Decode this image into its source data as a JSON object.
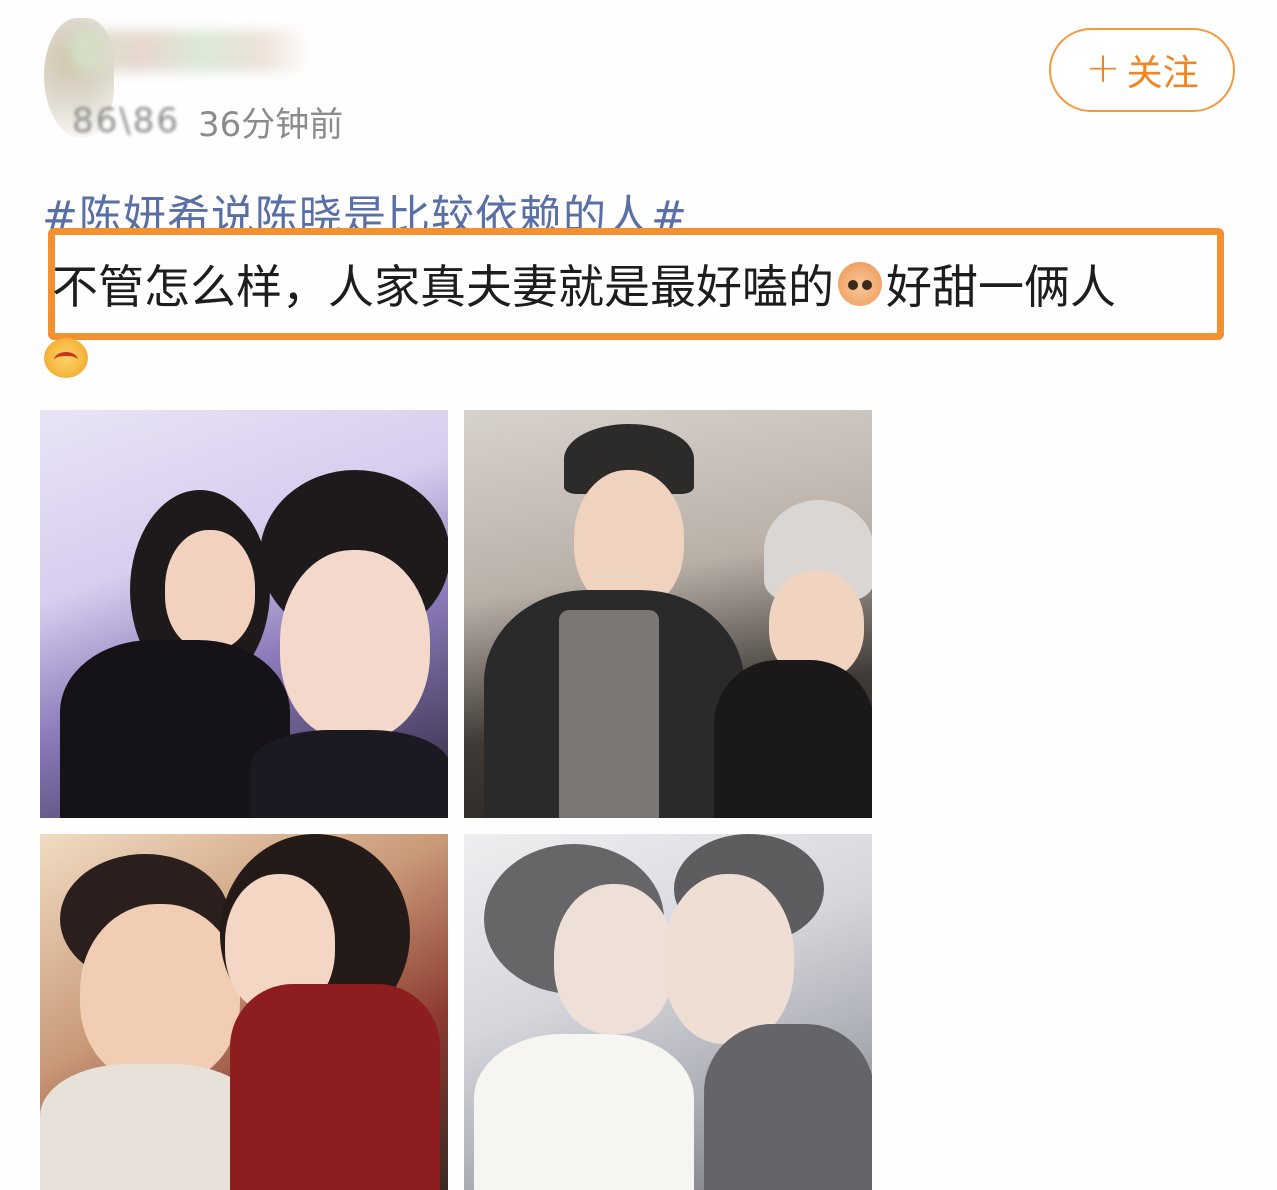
{
  "post": {
    "meta_handle": "86\\86",
    "time_ago": "36分钟前",
    "follow_plus": "+",
    "follow_label": "关注",
    "hashtag": "#陈妍希说陈晓是比较依赖的人#",
    "text_part1": "不管怎么样，人家真夫妻就是最好嗑的",
    "text_part2": "好甜一俩人"
  },
  "photos": [
    {
      "id": "photo-1",
      "subject": "couple-selfie"
    },
    {
      "id": "photo-2",
      "subject": "couple-casual"
    },
    {
      "id": "photo-3",
      "subject": "couple-kiss-red-dress"
    },
    {
      "id": "photo-4",
      "subject": "wedding-kiss-veil"
    }
  ],
  "colors": {
    "accent": "#f08522",
    "hashtag": "#5a6fa6",
    "highlight_border": "#f3902f"
  }
}
